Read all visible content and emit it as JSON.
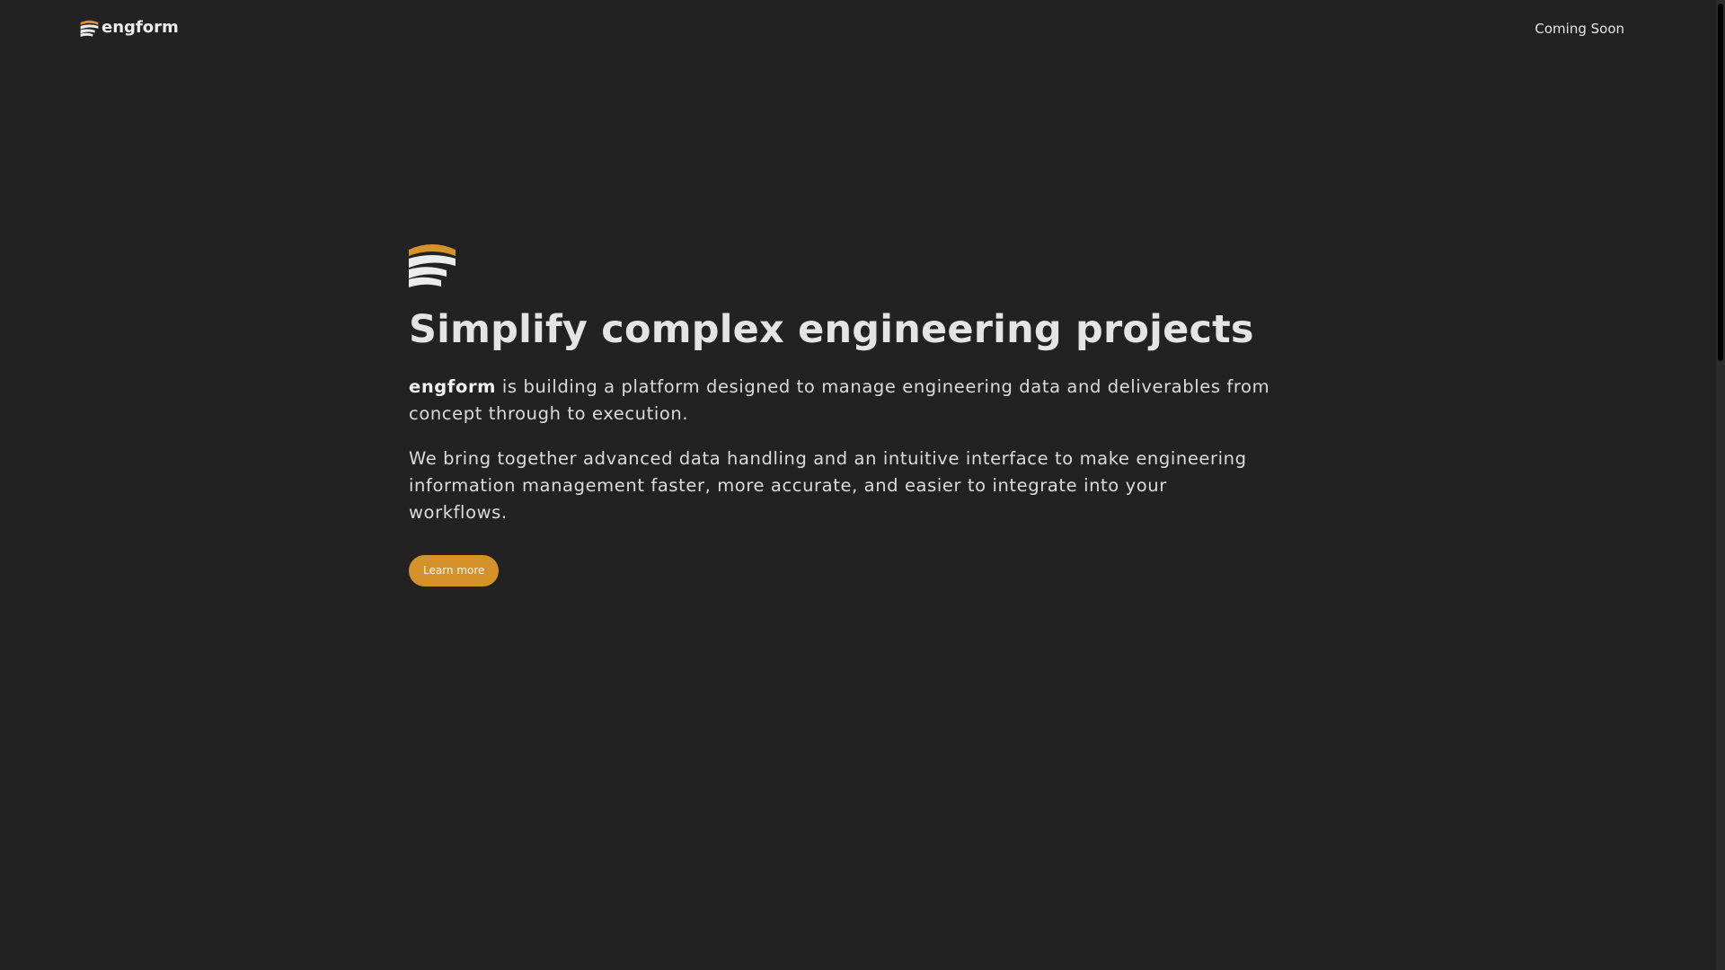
{
  "nav": {
    "brand_name": "engform",
    "coming_soon": "Coming Soon"
  },
  "hero": {
    "title": "Simplify complex engineering projects",
    "intro_brand": "engform",
    "intro_rest": " is building a platform designed to manage engineering data and deliverables from concept through to execution.",
    "second_paragraph": "We bring together advanced data handling and an intuitive interface to make engineering information management faster, more accurate, and easier to integrate into your workflows.",
    "cta_label": "Learn more"
  },
  "colors": {
    "background": "#222222",
    "accent": "#d5922b",
    "text": "#e4e4e4"
  },
  "icons": {
    "brand_logo": "stacked-layers-logo-icon",
    "hero_logo": "stacked-layers-logo-icon"
  }
}
